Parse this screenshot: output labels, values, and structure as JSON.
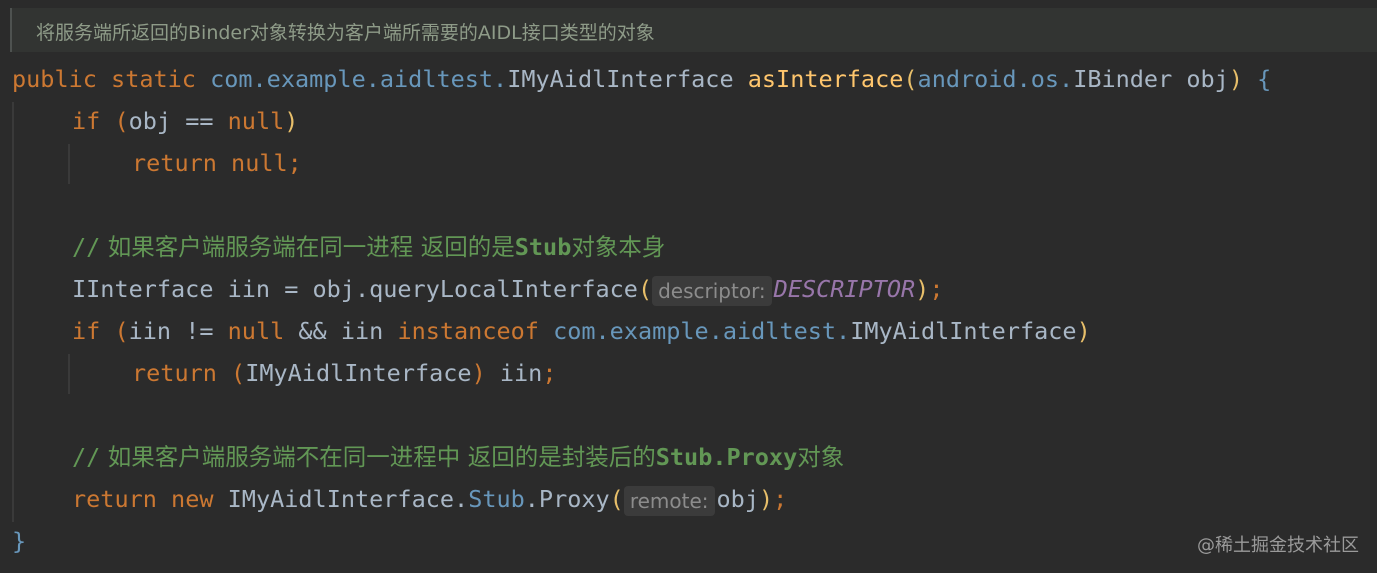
{
  "doc_comment": "将服务端所返回的Binder对象转换为客户端所需要的AIDL接口类型的对象",
  "lines": {
    "l1": {
      "kw1": "public",
      "kw2": "static",
      "pkg": "com.example.aidltest.",
      "type": "IMyAidlInterface",
      "fn": "asInterface",
      "p1": "(",
      "pkg2": "android.os.",
      "type2": "IBinder",
      "arg": "obj",
      "p2": ")",
      "brace": "{"
    },
    "l2": {
      "kw": "if",
      "p1": "(",
      "cond": "obj == ",
      "kw2": "null",
      "p2": ")"
    },
    "l3": {
      "kw": "return",
      "kw2": "null",
      "semi": ";"
    },
    "l5": {
      "slash": "//",
      "text": " 如果客户端服务端在同一进程 返回的是",
      "bold": "Stub",
      "text2": "对象本身"
    },
    "l6": {
      "type": "IInterface",
      "rest": " iin = obj.queryLocalInterface",
      "p1": "(",
      "hint": "descriptor:",
      "const": "DESCRIPTOR",
      "p2": ")",
      "semi": ";"
    },
    "l7": {
      "kw": "if",
      "p1": "(",
      "t1": "iin != ",
      "kw2": "null",
      "t2": " && iin ",
      "kw3": "instanceof",
      "pkg": "com.example.aidltest.",
      "type": "IMyAidlInterface",
      "p2": ")"
    },
    "l8": {
      "kw": "return",
      "p1": "(",
      "type": "IMyAidlInterface",
      "p2": ")",
      "rest": " iin",
      "semi": ";"
    },
    "l10": {
      "slash": "//",
      "text": " 如果客户端服务端不在同一进程中 返回的是封装后的",
      "bold": "Stub.Proxy",
      "text2": "对象"
    },
    "l11": {
      "kw": "return",
      "kw2": "new",
      "type": "IMyAidlInterface.",
      "stub": "Stub",
      "rest": ".Proxy",
      "p1": "(",
      "hint": "remote:",
      "arg": "obj",
      "p2": ")",
      "semi": ";"
    },
    "l12": {
      "brace": "}"
    }
  },
  "watermark": "@稀土掘金技术社区",
  "colors": {
    "background": "#2b2b2b",
    "keyword": "#cc7832",
    "package": "#6897bb",
    "function": "#ffc66d",
    "comment": "#629755",
    "constant": "#9876aa"
  }
}
